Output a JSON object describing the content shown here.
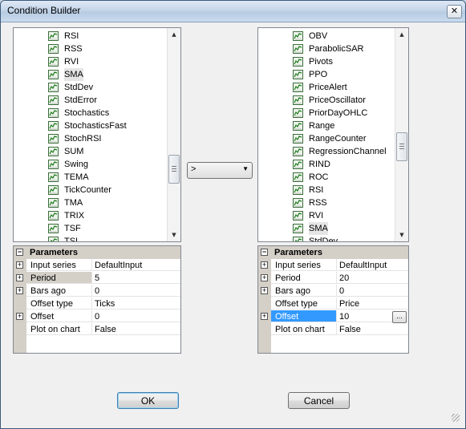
{
  "window": {
    "title": "Condition Builder",
    "close_label": "✕"
  },
  "left_list": {
    "items": [
      "RSI",
      "RSS",
      "RVI",
      "SMA",
      "StdDev",
      "StdError",
      "Stochastics",
      "StochasticsFast",
      "StochRSI",
      "SUM",
      "Swing",
      "TEMA",
      "TickCounter",
      "TMA",
      "TRIX",
      "TSF",
      "TSI"
    ],
    "selected": "SMA"
  },
  "right_list": {
    "items": [
      "OBV",
      "ParabolicSAR",
      "Pivots",
      "PPO",
      "PriceAlert",
      "PriceOscillator",
      "PriorDayOHLC",
      "Range",
      "RangeCounter",
      "RegressionChannel",
      "RIND",
      "ROC",
      "RSI",
      "RSS",
      "RVI",
      "SMA",
      "StdDev"
    ],
    "selected": "SMA"
  },
  "left_params": {
    "header": "Parameters",
    "rows": [
      {
        "name": "Input series",
        "value": "DefaultInput",
        "expandable": true
      },
      {
        "name": "Period",
        "value": "5",
        "expandable": true
      },
      {
        "name": "Bars ago",
        "value": "0",
        "expandable": true
      },
      {
        "name": "Offset type",
        "value": "Ticks",
        "expandable": false
      },
      {
        "name": "Offset",
        "value": "0",
        "expandable": true
      },
      {
        "name": "Plot on chart",
        "value": "False",
        "expandable": false
      }
    ]
  },
  "right_params": {
    "header": "Parameters",
    "rows": [
      {
        "name": "Input series",
        "value": "DefaultInput",
        "expandable": true
      },
      {
        "name": "Period",
        "value": "20",
        "expandable": true
      },
      {
        "name": "Bars ago",
        "value": "0",
        "expandable": true
      },
      {
        "name": "Offset type",
        "value": "Price",
        "expandable": false
      },
      {
        "name": "Offset",
        "value": "10",
        "expandable": true
      },
      {
        "name": "Plot on chart",
        "value": "False",
        "expandable": false
      }
    ],
    "ellipsis": "..."
  },
  "operator": {
    "value": ">",
    "arrow": "▼"
  },
  "buttons": {
    "ok": "OK",
    "cancel": "Cancel"
  },
  "scroll": {
    "up": "▲",
    "down": "▼"
  },
  "icons": {
    "list_item": "indicator-chart-icon",
    "expander": "plus-box-icon",
    "collapse": "minus-box-icon"
  },
  "colors": {
    "selection": "#3399ff",
    "grid_gutter": "#d4d0c8"
  }
}
